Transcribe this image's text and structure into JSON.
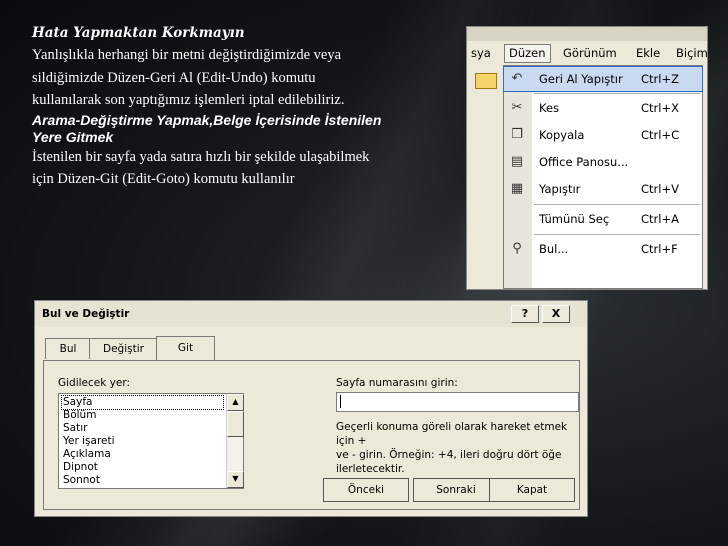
{
  "slide": {
    "heading1": "Hata Yapmaktan Korkmayın",
    "para1_lines": [
      "Yanlışlıkla herhangi bir metni değiştirdiğimizde veya",
      "sildiğimizde Düzen-Geri Al (Edit-Undo) komutu",
      "kullanılarak son yaptığımız işlemleri iptal edilebiliriz."
    ],
    "heading2_lines": [
      "Arama-Değiştirme Yapmak,Belge İçerisinde İstenilen",
      "Yere Gitmek"
    ],
    "para2_lines": [
      "İstenilen bir sayfa yada satıra hızlı bir şekilde ulaşabilmek",
      "için Düzen-Git (Edit-Goto) komutu kullanılır"
    ]
  },
  "word_menu": {
    "menubar": [
      "sya",
      "Düzen",
      "Görünüm",
      "Ekle",
      "Biçim"
    ],
    "items": [
      {
        "icon": "undo-icon",
        "glyph": "↶",
        "label": "Geri Al Yapıştır",
        "shortcut": "Ctrl+Z"
      },
      {
        "icon": "cut-icon",
        "glyph": "✂",
        "label": "Kes",
        "shortcut": "Ctrl+X"
      },
      {
        "icon": "copy-icon",
        "glyph": "❐",
        "label": "Kopyala",
        "shortcut": "Ctrl+C"
      },
      {
        "icon": "clipboard-icon",
        "glyph": "▤",
        "label": "Office Panosu...",
        "shortcut": ""
      },
      {
        "icon": "paste-icon",
        "glyph": "▦",
        "label": "Yapıştır",
        "shortcut": "Ctrl+V"
      },
      {
        "icon": "",
        "glyph": "",
        "label": "Tümünü Seç",
        "shortcut": "Ctrl+A"
      },
      {
        "icon": "binoculars-icon",
        "glyph": "⚲",
        "label": "Bul...",
        "shortcut": "Ctrl+F"
      }
    ],
    "expand_glyph": "¥"
  },
  "dialog": {
    "title": "Bul ve Değiştir",
    "help_btn": "?",
    "close_btn": "X",
    "tabs": [
      "Bul",
      "Değiştir",
      "Git"
    ],
    "active_tab": "Git",
    "goto_label": "Gidilecek yer:",
    "goto_items": [
      "Sayfa",
      "Bölüm",
      "Satır",
      "Yer işareti",
      "Açıklama",
      "Dipnot",
      "Sonnot"
    ],
    "selected_item": "Sayfa",
    "page_number_label": "Sayfa numarasını girin:",
    "page_number_value": "",
    "description_lines": [
      "Geçerli konuma göreli olarak hareket etmek için +",
      "ve - girin. Örneğin: +4, ileri doğru dört öğe",
      "ilerletecektir."
    ],
    "buttons": {
      "previous": "Önceki",
      "next": "Sonraki",
      "close": "Kapat"
    }
  }
}
